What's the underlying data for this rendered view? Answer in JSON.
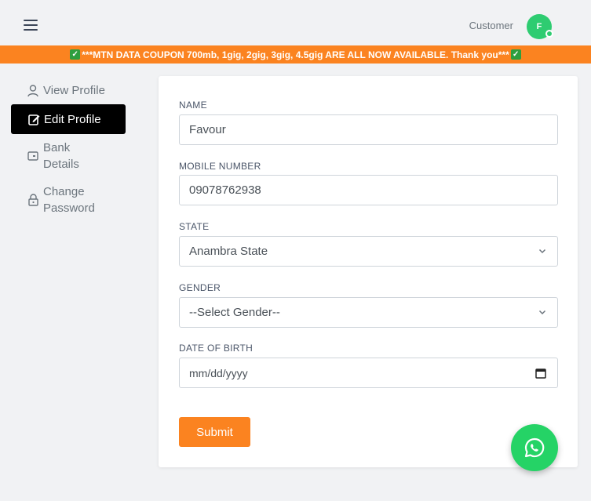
{
  "header": {
    "role": "Customer",
    "avatar_initial": "F"
  },
  "banner": {
    "text": "***MTN DATA COUPON 700mb, 1gig, 2gig, 3gig, 4.5gig ARE ALL NOW AVAILABLE. Thank you***"
  },
  "sidebar": {
    "items": [
      {
        "label": "View Profile",
        "icon": "user-icon",
        "active": false
      },
      {
        "label": "Edit Profile",
        "icon": "edit-icon",
        "active": true
      },
      {
        "label": "Bank Details",
        "icon": "bank-card-icon",
        "active": false
      },
      {
        "label": "Change Password",
        "icon": "lock-icon",
        "active": false
      }
    ]
  },
  "form": {
    "name_label": "NAME",
    "name_value": "Favour",
    "mobile_label": "MOBILE NUMBER",
    "mobile_value": "09078762938",
    "state_label": "STATE",
    "state_value": "Anambra State",
    "gender_label": "GENDER",
    "gender_value": "--Select Gender--",
    "dob_label": "DATE OF BIRTH",
    "dob_placeholder": "mm/dd/yyyy",
    "submit_label": "Submit"
  },
  "colors": {
    "accent": "#fb8320",
    "active_menu": "#000000",
    "whatsapp": "#25d366",
    "avatar": "#2ecc71"
  }
}
